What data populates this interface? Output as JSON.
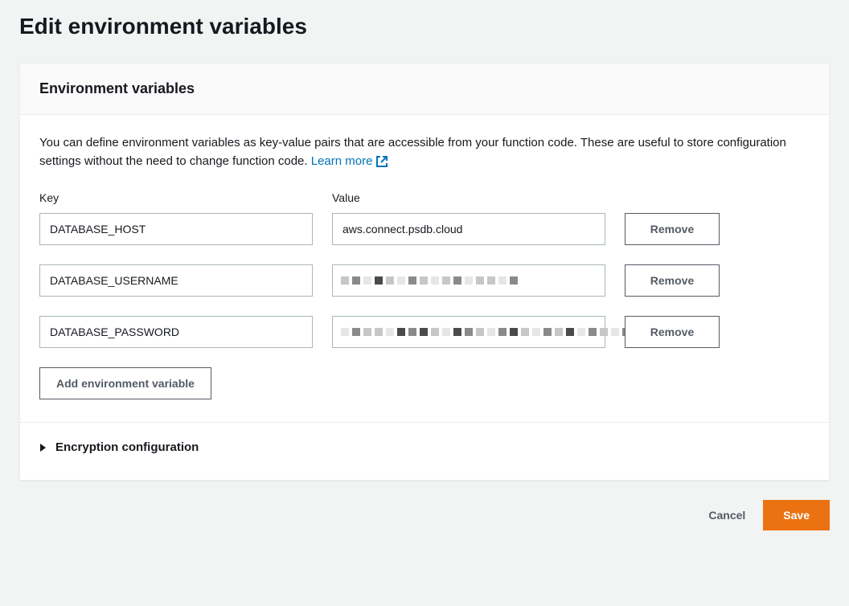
{
  "page": {
    "title": "Edit environment variables"
  },
  "panel": {
    "heading": "Environment variables",
    "description_prefix": "You can define environment variables as key-value pairs that are accessible from your function code. These are useful to store configuration settings without the need to change function code. ",
    "learn_more_label": "Learn more",
    "col_key_label": "Key",
    "col_value_label": "Value",
    "rows": [
      {
        "key": "DATABASE_HOST",
        "value": "aws.connect.psdb.cloud",
        "redacted": false
      },
      {
        "key": "DATABASE_USERNAME",
        "value": "",
        "redacted": true
      },
      {
        "key": "DATABASE_PASSWORD",
        "value": "",
        "redacted": true
      }
    ],
    "remove_label": "Remove",
    "add_label": "Add environment variable",
    "encryption_label": "Encryption configuration"
  },
  "footer": {
    "cancel_label": "Cancel",
    "save_label": "Save"
  }
}
